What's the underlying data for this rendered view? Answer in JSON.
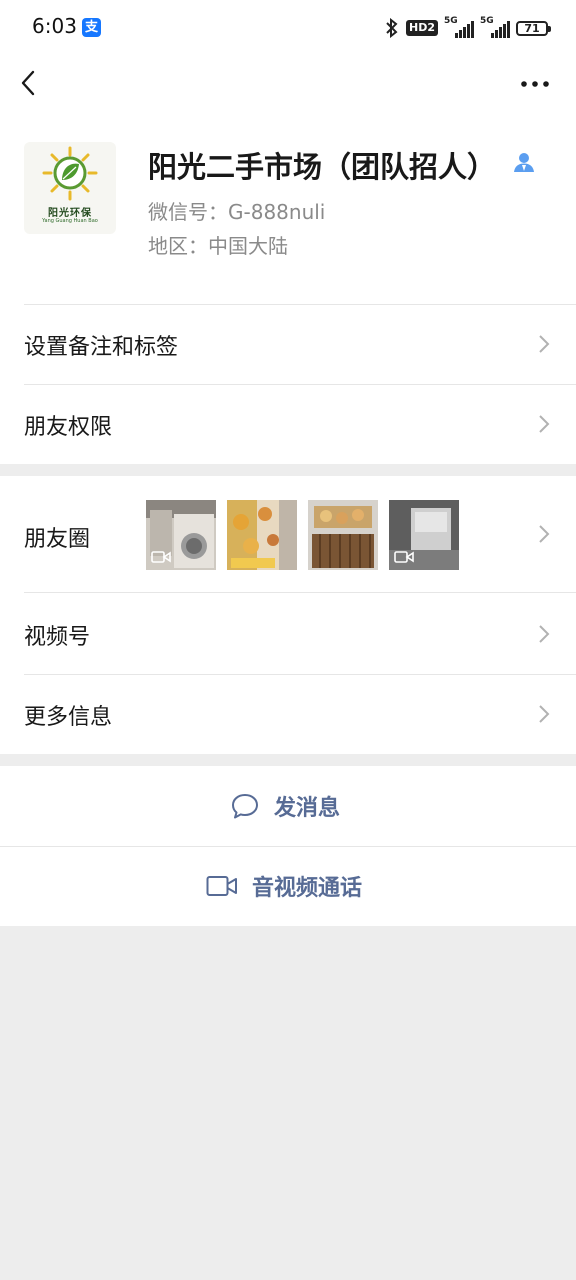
{
  "status_bar": {
    "time": "6:03",
    "alipay_badge": "支",
    "hd_label": "HD2",
    "signal_1_label": "5G",
    "signal_2_label": "5G",
    "battery_level": "71"
  },
  "profile": {
    "name": "阳光二手市场（团队招人）",
    "wechat_id": "微信号：G-888nuli",
    "region": "地区：中国大陆",
    "avatar_caption": "阳光环保",
    "avatar_subcaption": "Yang Guang Huan Bao"
  },
  "menu": {
    "remark_tags": "设置备注和标签",
    "friend_permissions": "朋友权限",
    "moments": "朋友圈",
    "channels": "视频号",
    "more_info": "更多信息"
  },
  "actions": {
    "send_message": "发消息",
    "video_call": "音视频通话"
  },
  "colors": {
    "link_blue": "#576b95",
    "background": "#ededed",
    "verify_blue": "#5b9ef0"
  },
  "icons": [
    "back-icon",
    "more-icon",
    "verified-user-icon",
    "chevron-right-icon",
    "chat-bubble-icon",
    "video-camera-icon"
  ]
}
